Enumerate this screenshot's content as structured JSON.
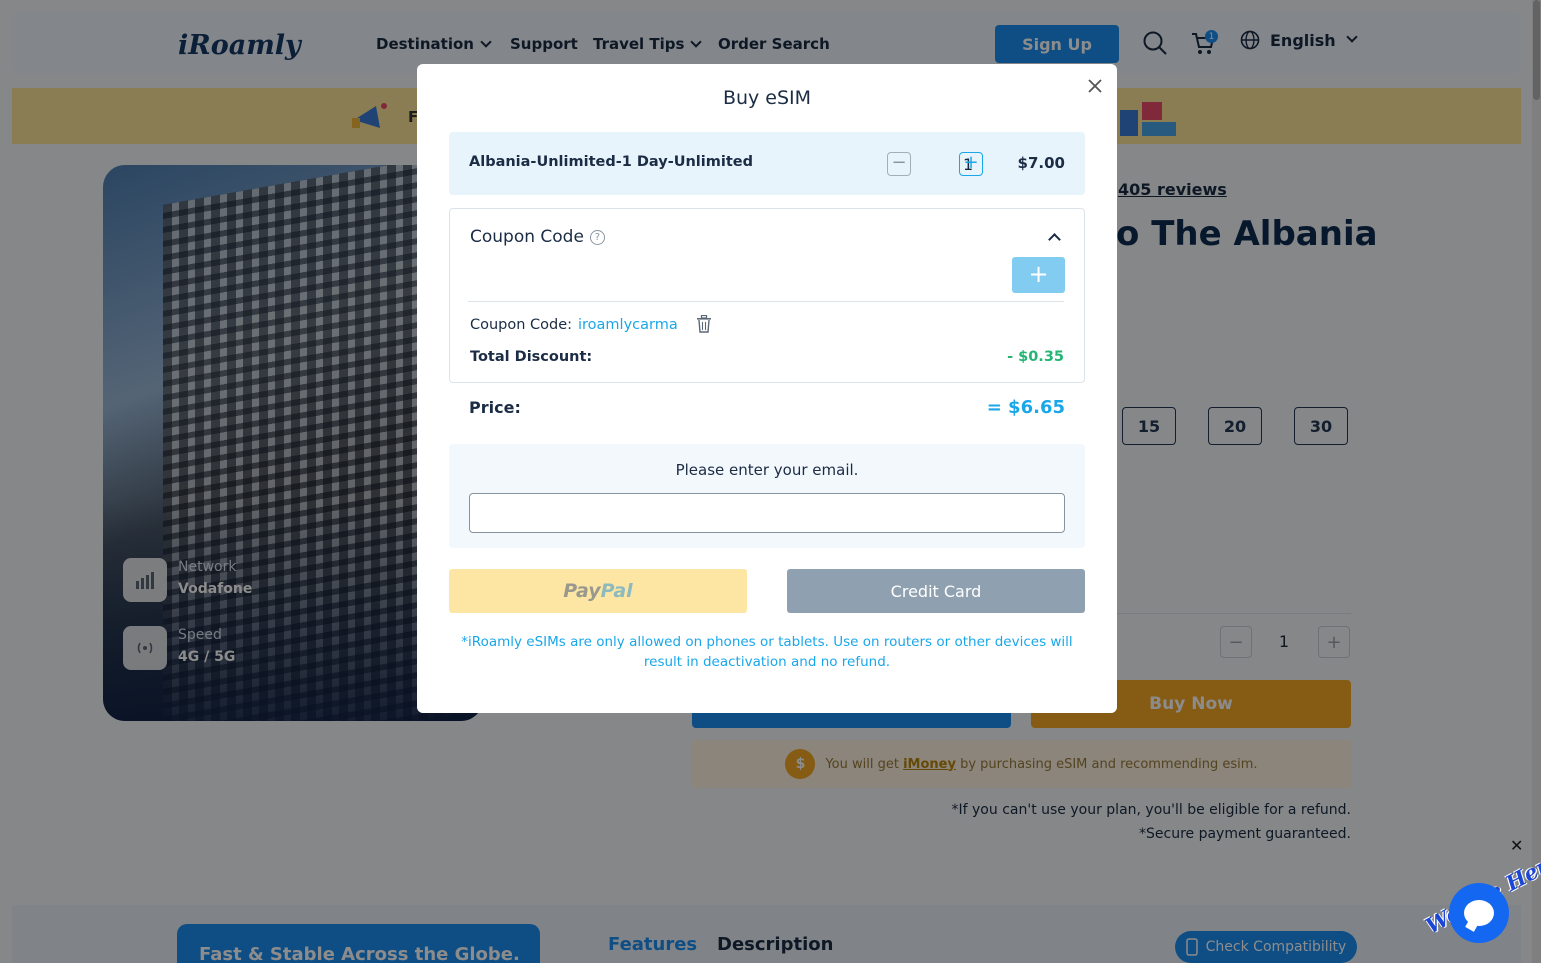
{
  "nav": {
    "logo": "iRoamly",
    "destination": "Destination",
    "support": "Support",
    "travel_tips": "Travel Tips",
    "order_search": "Order Search",
    "sign_up": "Sign Up",
    "cart_count": "1",
    "language": "English"
  },
  "promo": {
    "visible_text": "F"
  },
  "hero": {
    "network_label": "Network",
    "network_value": "Vodafone",
    "speed_label": "Speed",
    "speed_value": "4G / 5G"
  },
  "product": {
    "reviews": "405 reviews",
    "heading_fragment": "o The Albania",
    "day_options": [
      "15",
      "20",
      "30"
    ],
    "qty": "1",
    "buy_now": "Buy Now",
    "imoney_prefix": "You will get ",
    "imoney_link": "iMoney",
    "imoney_suffix": " by purchasing eSIM and recommending esim.",
    "refund_note": "*If you can't use your plan, you'll be eligible for a refund.",
    "secure_note": "*Secure payment guaranteed."
  },
  "bottom": {
    "fast_card": "Fast & Stable Across the Globe.",
    "tab_features": "Features",
    "tab_description": "Description",
    "check_compat": "Check Compatibility"
  },
  "chat": {
    "tag": "We Are Here!",
    "close": "✕"
  },
  "modal": {
    "title": "Buy eSIM",
    "product_name": "Albania-Unlimited-1 Day-Unlimited",
    "qty": "1",
    "unit_price": "$7.00",
    "coupon_title": "Coupon Code",
    "coupon_applied_label": "Coupon Code:",
    "coupon_applied_value": "iroamlycarma",
    "discount_label": "Total Discount:",
    "discount_value": "- $0.35",
    "price_label": "Price:",
    "price_value": "= $6.65",
    "email_label": "Please enter your email.",
    "paypal_pay": "Pay",
    "paypal_pal": "Pal",
    "credit_card": "Credit Card",
    "notice": "*iRoamly eSIMs are only allowed on phones or tablets. Use on routers or other devices will result in deactivation and no refund."
  },
  "colors": {
    "accent": "#1aa7ea",
    "primary_button": "#1b8ef0",
    "discount_green": "#22b573",
    "buy_now_orange": "#f5a623"
  }
}
